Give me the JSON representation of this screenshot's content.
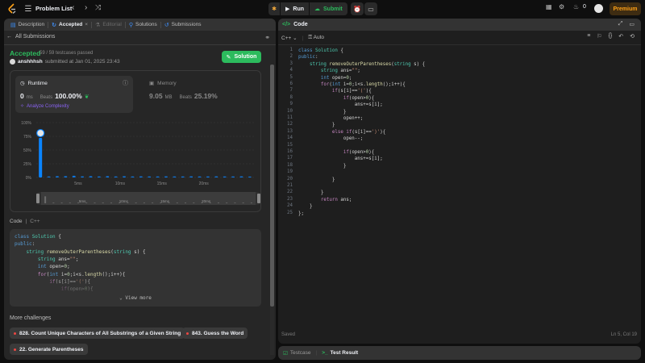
{
  "topnav": {
    "problem_list": "Problem List",
    "run": "Run",
    "submit": "Submit",
    "streak": "0",
    "premium": "Premium"
  },
  "left_tabs": [
    {
      "label": "Description"
    },
    {
      "label": "Accepted",
      "close": "×"
    },
    {
      "label": "Editorial"
    },
    {
      "label": "Solutions"
    },
    {
      "label": "Submissions"
    }
  ],
  "submission": {
    "back_label": "All Submissions",
    "status": "Accepted",
    "testcases": "59 / 59 testcases passed",
    "user": "anshhhsh",
    "submitted": "submitted at Jan 01, 2025 23:43",
    "solution_btn": "Solution"
  },
  "runtime": {
    "label": "Runtime",
    "value": "0",
    "unit": "ms",
    "beats_label": "Beats",
    "beats": "100.00%",
    "analyze": "Analyze Complexity"
  },
  "memory": {
    "label": "Memory",
    "value": "9.05",
    "unit": "MB",
    "beats_label": "Beats",
    "beats": "25.19%"
  },
  "chart_data": {
    "type": "bar",
    "title": "",
    "xlabel": "",
    "ylabel": "",
    "y_ticks": [
      "100%",
      "75%",
      "50%",
      "25%",
      "0%"
    ],
    "x_ticks": [
      "5ms",
      "10ms",
      "15ms",
      "20ms"
    ],
    "slider_ticks": [
      "5ms",
      "10ms",
      "15ms",
      "20ms"
    ],
    "ylim": [
      0,
      100
    ],
    "values": [
      72,
      1.8,
      2.4,
      2.4,
      3.2,
      2.1,
      2.3,
      1.9,
      2.3,
      1.9,
      2.2,
      1.8,
      2.0,
      1.8,
      1.8,
      2.0,
      1.8,
      1.8,
      2.0,
      1.8,
      1.8,
      2.1,
      1.9,
      1.8,
      2.0,
      1.7
    ],
    "highlight_index": 0,
    "bar_color": "#0a84ff"
  },
  "code_section": {
    "label": "Code",
    "lang": "C++",
    "snippet": [
      "class Solution {",
      "public:",
      "    string removeOuterParentheses(string s) {",
      "        string ans=\"\";",
      "        int open=0;",
      "        for(int i=0;i<s.length();i++){",
      "            if(s[i]=='('){",
      "                if(open>0){"
    ],
    "view_more": "View more"
  },
  "more_challenges": {
    "label": "More challenges",
    "items": [
      "828. Count Unique Characters of All Substrings of a Given String",
      "843. Guess the Word",
      "22. Generate Parentheses"
    ]
  },
  "editor": {
    "title": "Code",
    "lang": "C++",
    "mode": "Auto",
    "saved": "Saved",
    "cursor": "Ln 5, Col 19",
    "lines": [
      "class Solution {",
      "public:",
      "    string removeOuterParentheses(string s) {",
      "        string ans=\"\";",
      "        int open=0;",
      "        for(int i=0;i<s.length();i++){",
      "            if(s[i]=='('){",
      "                if(open>0){",
      "                    ans+=s[i];",
      "                }",
      "                open++;",
      "            }",
      "            else if(s[i]==')'){",
      "                open--;",
      "",
      "                if(open>0){",
      "                    ans+=s[i];",
      "                }",
      "",
      "            }",
      "",
      "        }",
      "        return ans;",
      "    }",
      "};"
    ]
  },
  "bottom_tabs": {
    "testcase": "Testcase",
    "test_result": "Test Result"
  },
  "colors": {
    "accent_green": "#2cbb5d",
    "brand_orange": "#ffa116",
    "chart_blue": "#0a84ff",
    "panel_bg": "#262626",
    "editor_bg": "#1e1e1e"
  },
  "icons": [
    "logo-icon",
    "list-icon",
    "chevron-left-icon",
    "chevron-right-icon",
    "shuffle-icon",
    "bug-icon",
    "play-icon",
    "cloud-upload-icon",
    "alarm-icon",
    "note-icon",
    "grid-icon",
    "gear-icon",
    "fire-icon",
    "file-icon",
    "check-icon",
    "close-icon",
    "flask-icon",
    "beaker-icon",
    "history-icon",
    "back-arrow-icon",
    "link-icon",
    "clock-icon",
    "info-icon",
    "chip-icon",
    "code-icon",
    "expand-icon",
    "minimize-icon",
    "lock-icon",
    "bookmark-icon",
    "braces-icon",
    "undo-icon",
    "reset-icon",
    "testcase-icon",
    "terminal-icon"
  ]
}
